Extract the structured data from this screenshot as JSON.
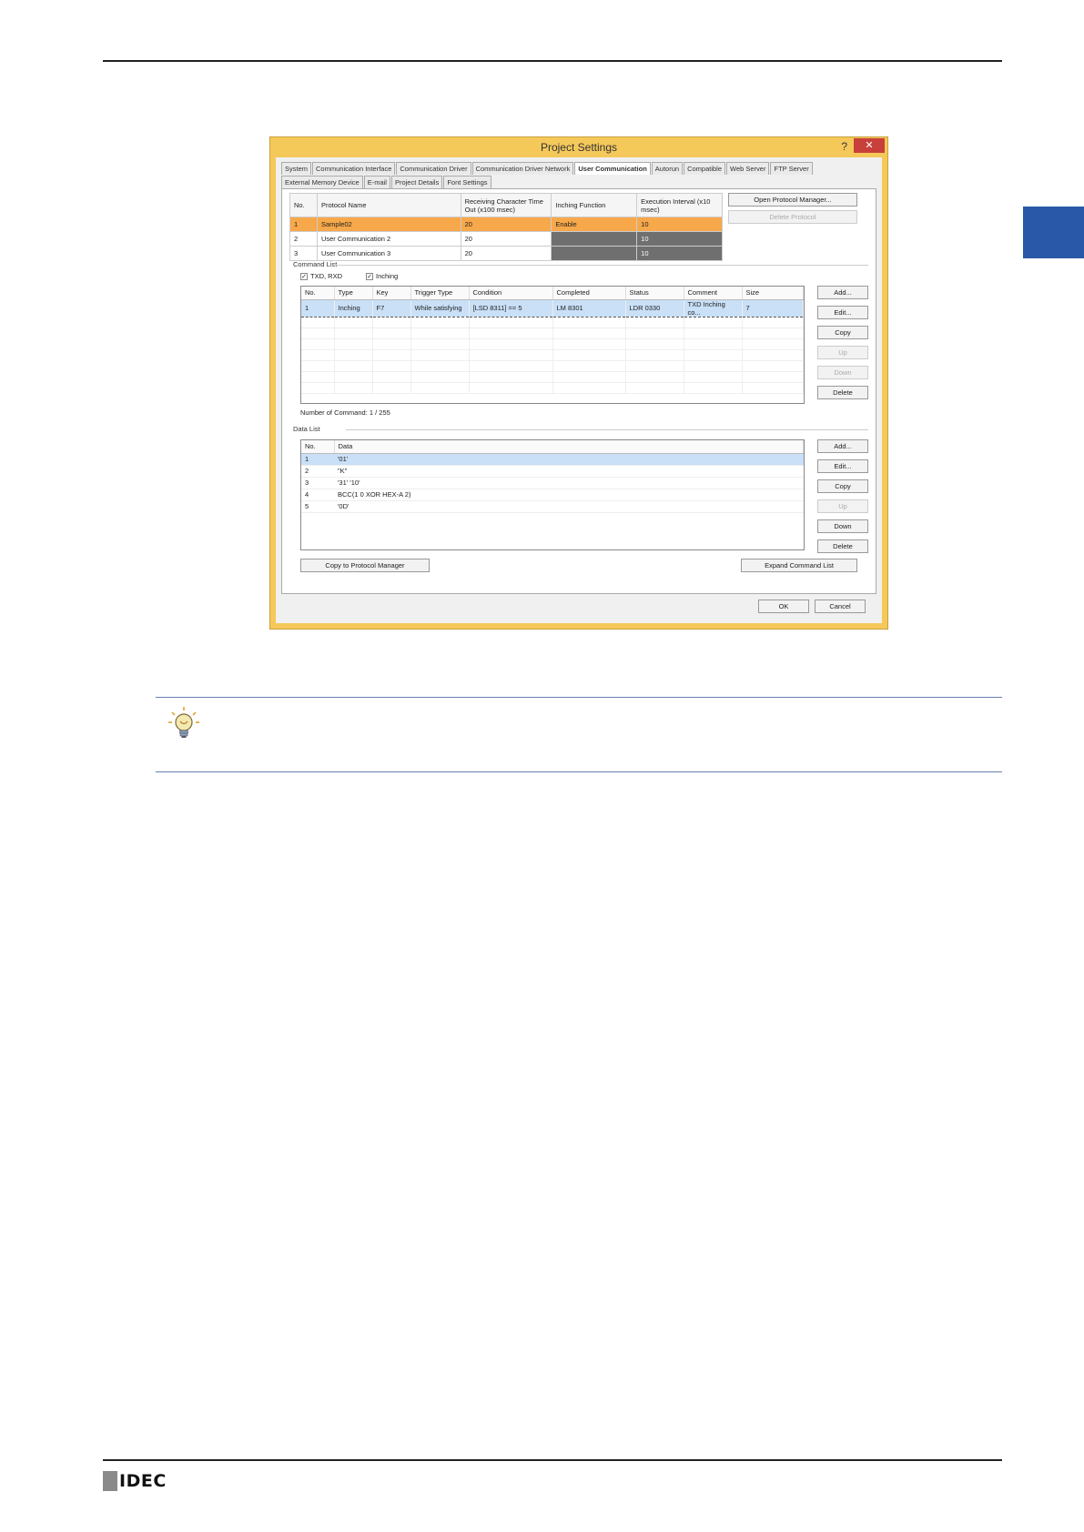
{
  "dialog": {
    "title": "Project Settings",
    "help_label": "?",
    "close_label": "✕",
    "tabs_row1": [
      "System",
      "Communication Interface",
      "Communication Driver",
      "Communication Driver Network",
      "User Communication",
      "Autorun",
      "Compatible",
      "Web Server",
      "FTP Server"
    ],
    "tabs_row2": [
      "External Memory Device",
      "E-mail",
      "Project Details",
      "Font Settings"
    ],
    "active_tab": "User Communication"
  },
  "protocol_table": {
    "headers": [
      "No.",
      "Protocol Name",
      "Receiving Character Time Out (x100 msec)",
      "Inching Function",
      "Execution Interval (x10 msec)"
    ],
    "rows": [
      [
        "1",
        "Sample02",
        "20",
        "Enable",
        "10"
      ],
      [
        "2",
        "User Communication 2",
        "20",
        "",
        "10"
      ],
      [
        "3",
        "User Communication 3",
        "20",
        "",
        "10"
      ]
    ]
  },
  "buttons": {
    "open_protocol_manager": "Open Protocol Manager...",
    "delete_protocol": "Delete Protocol",
    "cmd_add": "Add...",
    "cmd_edit": "Edit...",
    "cmd_copy": "Copy",
    "cmd_up": "Up",
    "cmd_down": "Down",
    "cmd_delete": "Delete",
    "data_add": "Add...",
    "data_edit": "Edit...",
    "data_copy": "Copy",
    "data_up": "Up",
    "data_down": "Down",
    "data_delete": "Delete",
    "copy_to_protocol_manager": "Copy to Protocol Manager",
    "expand_command_list": "Expand Command List",
    "ok": "OK",
    "cancel": "Cancel"
  },
  "command_list": {
    "label": "Command List",
    "txd_rxd_label": "TXD, RXD",
    "inching_label": "Inching",
    "headers": [
      "No.",
      "Type",
      "Key",
      "Trigger Type",
      "Condition",
      "Completed",
      "Status",
      "Comment",
      "Size"
    ],
    "rows": [
      [
        "1",
        "Inching",
        "F7",
        "While satisfying",
        "[LSD 8311] == 5",
        "LM 8301",
        "LDR 0330",
        "TXD Inching co...",
        "7"
      ]
    ],
    "count_text": "Number of Command: 1 / 255"
  },
  "data_list": {
    "label": "Data List",
    "headers": [
      "No.",
      "Data"
    ],
    "rows": [
      [
        "1",
        "'01'"
      ],
      [
        "2",
        "\"K\""
      ],
      [
        "3",
        "'31' '10'"
      ],
      [
        "4",
        "BCC(1 0 XOR HEX-A 2)"
      ],
      [
        "5",
        "'0D'"
      ]
    ]
  },
  "footer": {
    "logo_text": "IDEC"
  },
  "colors": {
    "dialog_frame": "#f5c85a",
    "selected_row": "#f7a84a",
    "side_tab": "#2a58a8"
  }
}
